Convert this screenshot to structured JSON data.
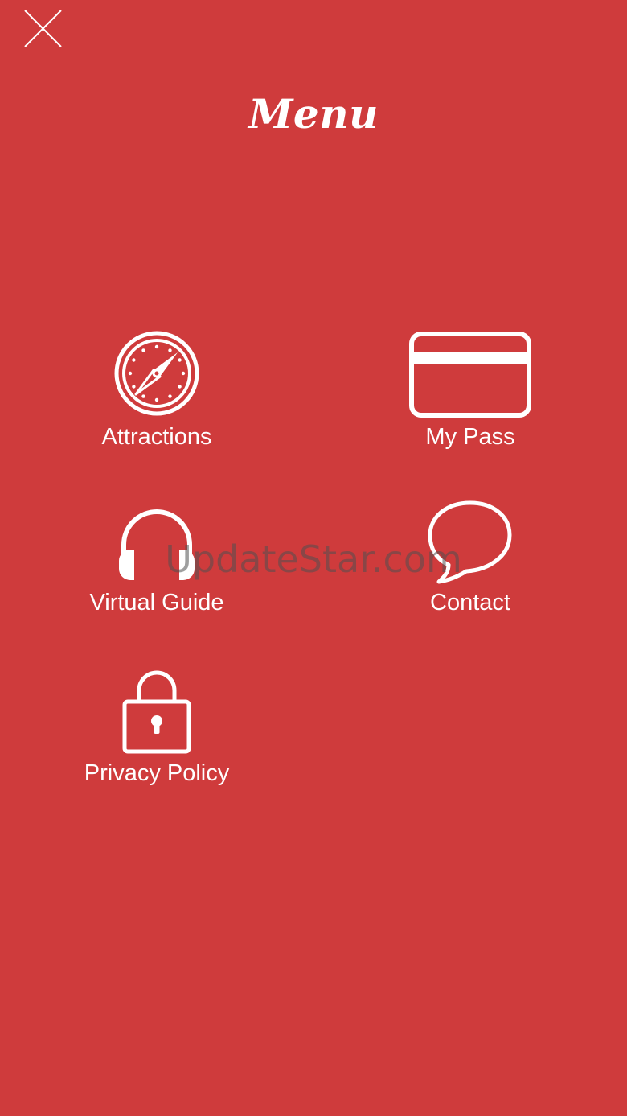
{
  "header": {
    "title": "Menu"
  },
  "icons": {
    "close": "close-icon",
    "attractions": "compass-icon",
    "my_pass": "card-icon",
    "virtual_guide": "headphones-icon",
    "contact": "speech-bubble-icon",
    "privacy_policy": "lock-icon"
  },
  "menu": {
    "items": [
      {
        "label": "Attractions"
      },
      {
        "label": "My Pass"
      },
      {
        "label": "Virtual Guide"
      },
      {
        "label": "Contact"
      },
      {
        "label": "Privacy Policy"
      }
    ]
  },
  "watermark": {
    "text": "UpdateStar.com"
  },
  "colors": {
    "background": "#cf3b3c",
    "foreground": "#ffffff"
  }
}
